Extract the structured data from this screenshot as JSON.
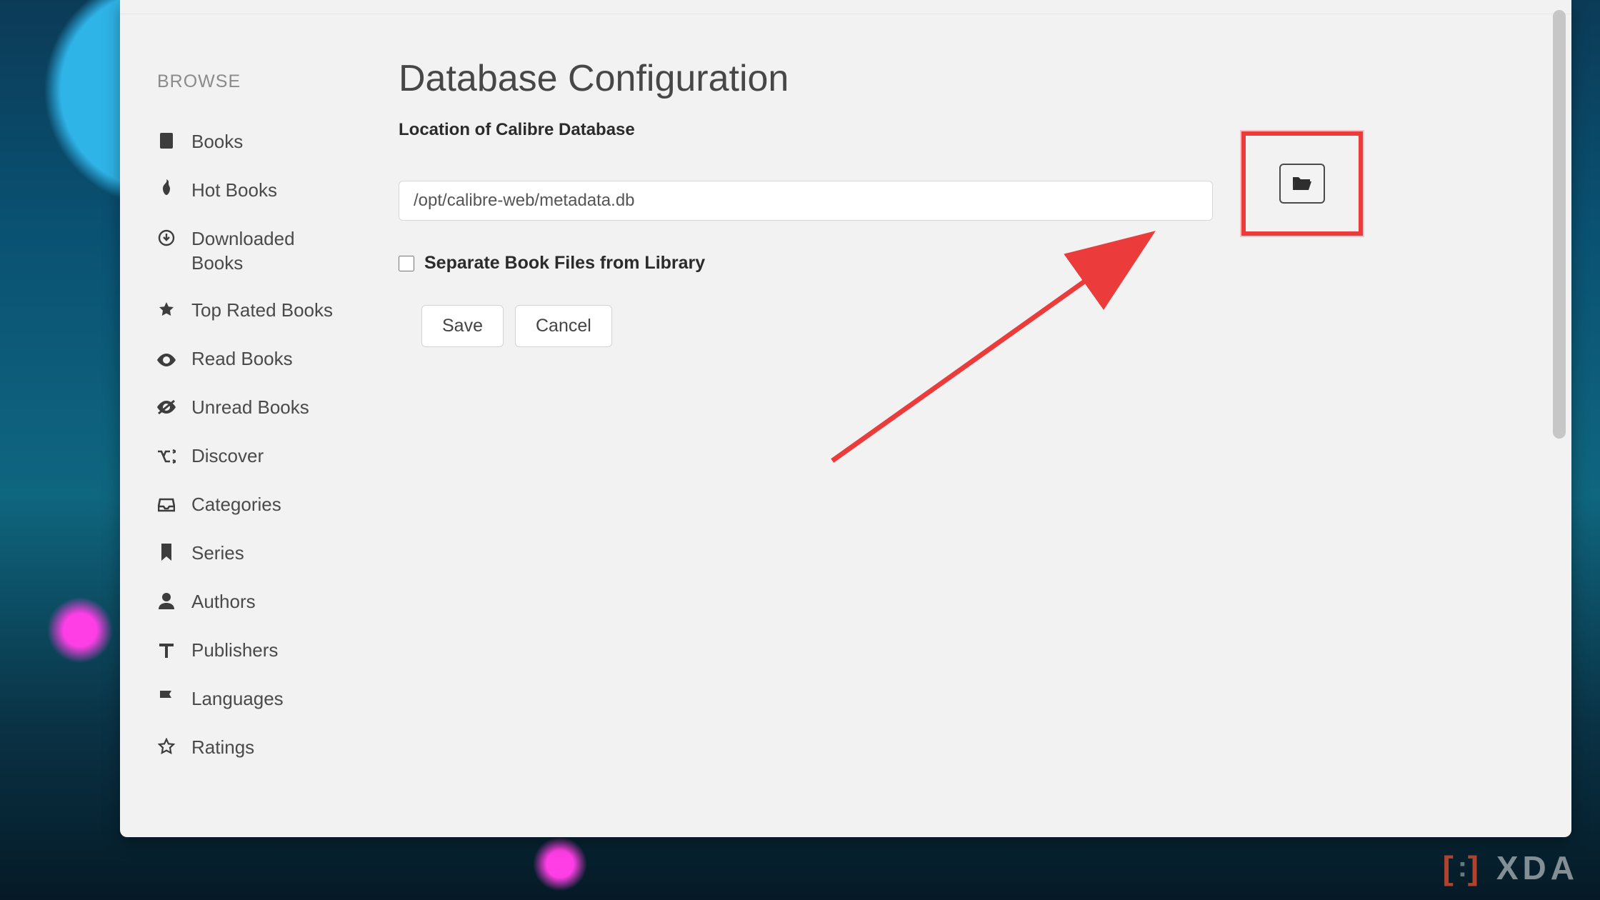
{
  "sidebar": {
    "heading": "BROWSE",
    "items": [
      {
        "icon": "book-icon",
        "label": "Books"
      },
      {
        "icon": "fire-icon",
        "label": "Hot Books"
      },
      {
        "icon": "download-circle-icon",
        "label": "Downloaded Books"
      },
      {
        "icon": "star-icon",
        "label": "Top Rated Books"
      },
      {
        "icon": "eye-icon",
        "label": "Read Books"
      },
      {
        "icon": "eye-slash-icon",
        "label": "Unread Books"
      },
      {
        "icon": "shuffle-icon",
        "label": "Discover"
      },
      {
        "icon": "inbox-icon",
        "label": "Categories"
      },
      {
        "icon": "bookmark-icon",
        "label": "Series"
      },
      {
        "icon": "user-icon",
        "label": "Authors"
      },
      {
        "icon": "type-icon",
        "label": "Publishers"
      },
      {
        "icon": "flag-icon",
        "label": "Languages"
      },
      {
        "icon": "star-outline-icon",
        "label": "Ratings"
      }
    ]
  },
  "main": {
    "title": "Database Configuration",
    "db_label": "Location of Calibre Database",
    "db_value": "/opt/calibre-web/metadata.db",
    "separate_label": "Separate Book Files from Library",
    "separate_checked": false,
    "save_label": "Save",
    "cancel_label": "Cancel"
  },
  "watermark": "XDA",
  "colors": {
    "highlight": "#ec3b3b"
  }
}
